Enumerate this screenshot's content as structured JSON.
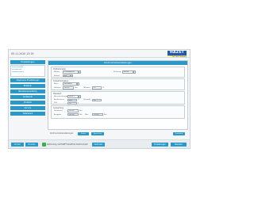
{
  "header": {
    "datetime": "05.11.2020 13:19",
    "logo_text": "HAZET",
    "logo_sub": "The Tool Company"
  },
  "sidebar": {
    "title": "Einstellungen",
    "items": [
      "Drehmoment",
      "Drehwinkel",
      "Messprotokoll"
    ],
    "buttons": [
      "Allgemeine Einstellungen",
      "Bediener",
      "Benutzerverwaltung",
      "Geräteinfo",
      "Protokoll",
      "Service",
      "Datenbank"
    ]
  },
  "panel": {
    "title": "Drehmomenteinstellungen",
    "groups": [
      {
        "title": "Prüfparameter",
        "fields": [
          {
            "label": "Modus",
            "value": "Drehmoment"
          },
          {
            "label": "Richtung",
            "value": "Rechts"
          },
          {
            "label": "Einheit",
            "value": "Nm"
          }
        ]
      },
      {
        "title": "Sollwertvorgaben",
        "fields": [
          {
            "label": "Nenn",
            "value": "Einzelwert"
          },
          {
            "label": "Sollwert",
            "value": "200,00"
          },
          {
            "label": "Toleranz",
            "value": "5,0"
          }
        ]
      },
      {
        "title": "Messwert",
        "fields": [
          {
            "label": "Messwertanzeige",
            "value": "aktuell"
          },
          {
            "label": "Auslösewert",
            "value": "10,0"
          },
          {
            "label": "Zeit",
            "value": "1,0"
          },
          {
            "label": "Schwelle",
            "value": "2,0"
          }
        ]
      },
      {
        "title": "Auswertung",
        "fields": [
          {
            "label": "Grenzwert",
            "value": "190,00"
          },
          {
            "label": "Ausgabe",
            "value": "200,00"
          },
          {
            "label": "Max",
            "value": "210,00"
          }
        ]
      }
    ],
    "units": [
      "Nm",
      "%",
      "s"
    ]
  },
  "bottom": {
    "label": "Drehmomenteinstellungen",
    "buttons": [
      "Laden",
      "Speichern",
      "Standard"
    ]
  },
  "footer": {
    "left_buttons": [
      "Zurück",
      "Drucken"
    ],
    "status_text": "Verbindung mit HAZET SmartTAC Drehmoment",
    "middle_button": "Verbinden",
    "right_buttons": [
      "Einstellungen",
      "Beenden"
    ]
  },
  "colors": {
    "accent": "#2a98c8",
    "brand": "#1e5aa8",
    "brand_yellow": "#f3c314",
    "status_ok": "#3fae49"
  }
}
